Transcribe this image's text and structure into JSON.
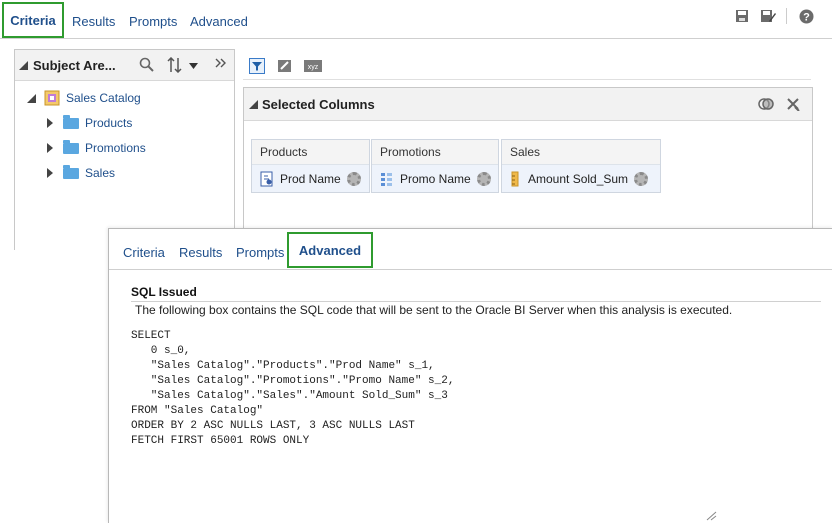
{
  "top_tabs": [
    {
      "label": "Criteria",
      "active": true
    },
    {
      "label": "Results",
      "active": false
    },
    {
      "label": "Prompts",
      "active": false
    },
    {
      "label": "Advanced",
      "active": false
    }
  ],
  "toolbar_icons": [
    "save-icon",
    "save-as-icon",
    "help-icon"
  ],
  "subject_area": {
    "title": "Subject Are...",
    "catalog": "Sales Catalog",
    "folders": [
      "Products",
      "Promotions",
      "Sales"
    ]
  },
  "selected_columns": {
    "title": "Selected Columns",
    "columns": [
      {
        "header": "Products",
        "value": "Prod Name"
      },
      {
        "header": "Promotions",
        "value": "Promo Name"
      },
      {
        "header": "Sales",
        "value": "Amount Sold_Sum"
      }
    ]
  },
  "front_tabs": [
    {
      "label": "Criteria",
      "active": false
    },
    {
      "label": "Results",
      "active": false
    },
    {
      "label": "Prompts",
      "active": false
    },
    {
      "label": "Advanced",
      "active": true
    }
  ],
  "sql": {
    "title": "SQL Issued",
    "description": "The following box contains the SQL code that will be sent to the Oracle BI Server when this analysis is executed.",
    "code": "SELECT\n   0 s_0,\n   \"Sales Catalog\".\"Products\".\"Prod Name\" s_1,\n   \"Sales Catalog\".\"Promotions\".\"Promo Name\" s_2,\n   \"Sales Catalog\".\"Sales\".\"Amount Sold_Sum\" s_3\nFROM \"Sales Catalog\"\nORDER BY 2 ASC NULLS LAST, 3 ASC NULLS LAST\nFETCH FIRST 65001 ROWS ONLY"
  },
  "colors": {
    "active_outline": "#2f9b2f",
    "link": "#1f4f8b",
    "folder": "#5aa7e0"
  }
}
